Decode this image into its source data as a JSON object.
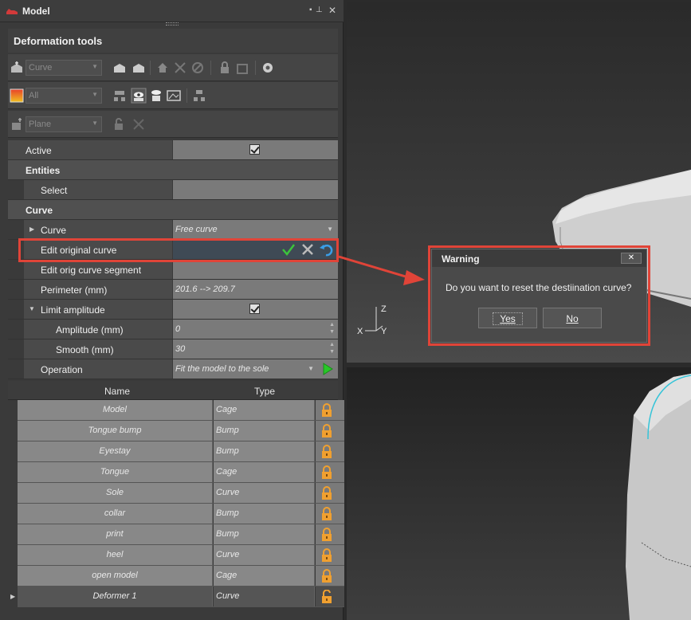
{
  "window": {
    "title": "Model"
  },
  "section": {
    "title": "Deformation tools"
  },
  "toolbar": {
    "curve_combo": "Curve",
    "filter_combo": "All",
    "plane_combo": "Plane"
  },
  "properties": {
    "active_label": "Active",
    "entities_group": "Entities",
    "select_label": "Select",
    "curve_group": "Curve",
    "curve_label": "Curve",
    "curve_value": "Free curve",
    "edit_original_label": "Edit original curve",
    "edit_segment_label": "Edit orig curve segment",
    "perimeter_label": "Perimeter (mm)",
    "perimeter_value": "201.6 --> 209.7",
    "limit_amplitude_label": "Limit amplitude",
    "amplitude_label": "Amplitude (mm)",
    "amplitude_value": "0",
    "smooth_label": "Smooth (mm)",
    "smooth_value": "30",
    "operation_label": "Operation",
    "operation_value": "Fit the model to the sole"
  },
  "table": {
    "headers": [
      "Name",
      "Type"
    ],
    "rows": [
      {
        "name": "Model",
        "type": "Cage"
      },
      {
        "name": "Tongue bump",
        "type": "Bump"
      },
      {
        "name": "Eyestay",
        "type": "Bump"
      },
      {
        "name": "Tongue",
        "type": "Cage"
      },
      {
        "name": "Sole",
        "type": "Curve"
      },
      {
        "name": "collar",
        "type": "Bump"
      },
      {
        "name": "print",
        "type": "Bump"
      },
      {
        "name": "heel",
        "type": "Curve"
      },
      {
        "name": "open model",
        "type": "Cage"
      },
      {
        "name": "Deformer 1",
        "type": "Curve"
      }
    ]
  },
  "viewport": {
    "axis_z": "Z",
    "axis_x": "X",
    "axis_y": "Y"
  },
  "dialog": {
    "title": "Warning",
    "close": "✕",
    "message": "Do you want to reset the destiination curve?",
    "yes": "Yes",
    "no": "No"
  },
  "colors": {
    "highlight": "#e04438",
    "accept": "#3cc43c",
    "undo": "#3a9ee8",
    "lock": "#f0a030"
  }
}
